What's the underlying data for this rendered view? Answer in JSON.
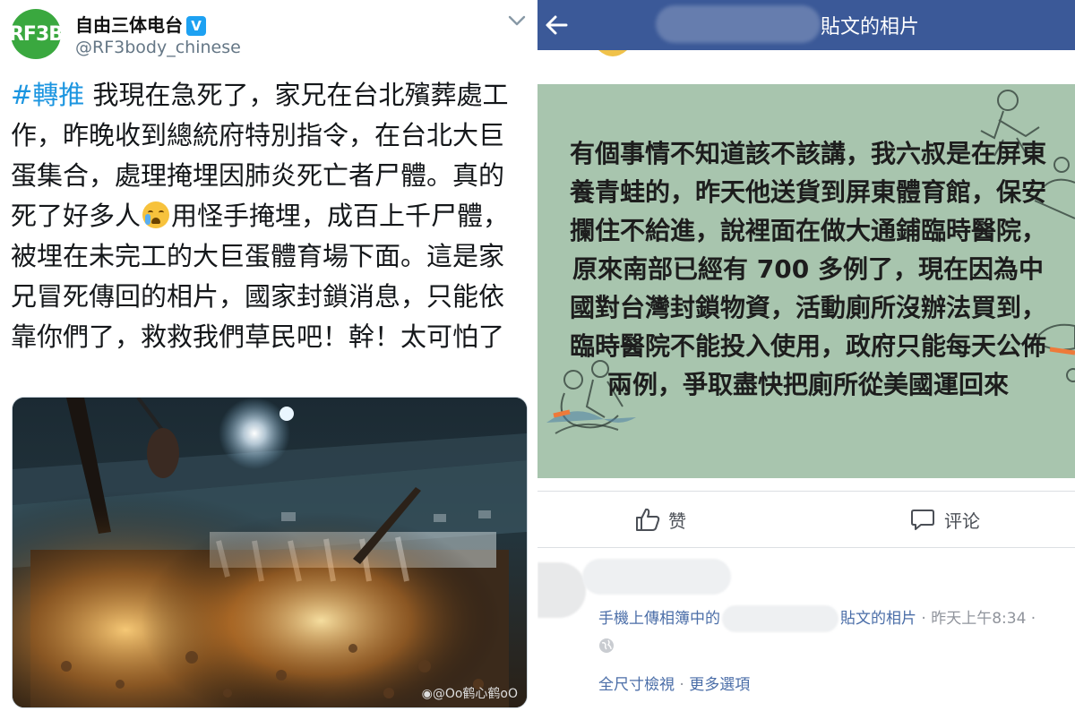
{
  "tweet": {
    "avatar_text": "RF3B",
    "display_name": "自由三体电台",
    "verified_mark": "V",
    "handle": "@RF3body_chinese",
    "hashtag": "#轉推",
    "text_before_emoji": " 我現在急死了，家兄在台北殯葬處工作，昨晚收到總統府特別指令，在台北大巨蛋集合，處理掩埋因肺炎死亡者尸體。真的死了好多人",
    "emoji": "loudly-crying-face-emoji",
    "text_after_emoji": "用怪手掩埋，成百上千尸體，被埋在未完工的大巨蛋體育場下面。這是家兄冒死傳回的相片，國家封鎖消息，只能依靠你們了，救救我們草民吧！幹！太可怕了",
    "photo_watermark": "@Oo鹤心鹤oO",
    "icons": {
      "menu": "chevron-down-icon",
      "verified": "verified-badge-icon",
      "watermark": "weibo-icon"
    }
  },
  "facebook": {
    "header_title": "貼文的相片",
    "image_text": "有個事情不知道該不該講，我六叔是在屏東養青蛙的，昨天他送貨到屏東體育館，保安攔住不給進，說裡面在做大通鋪臨時醫院，原來南部已經有 700 多例了，現在因為中國對台灣封鎖物資，活動廁所沒辦法買到，臨時醫院不能投入使用，政府只能每天公佈兩例，爭取盡快把廁所從美國運回來",
    "like_label": "赞",
    "comment_label": "评论",
    "meta_prefix": "手機上傳相簿中的",
    "meta_suffix": "貼文的相片",
    "meta_time": " · 昨天上午8:34 ·",
    "link_full_size": "全尺寸檢視",
    "link_separator": " · ",
    "link_more": "更多選項",
    "icons": {
      "back": "back-arrow-icon",
      "like": "thumbs-up-icon",
      "comment": "comment-bubble-icon",
      "privacy": "globe-icon"
    },
    "colors": {
      "header": "#3b5998",
      "link": "#4b6ea8",
      "image_bg": "#a8c5ae"
    }
  }
}
